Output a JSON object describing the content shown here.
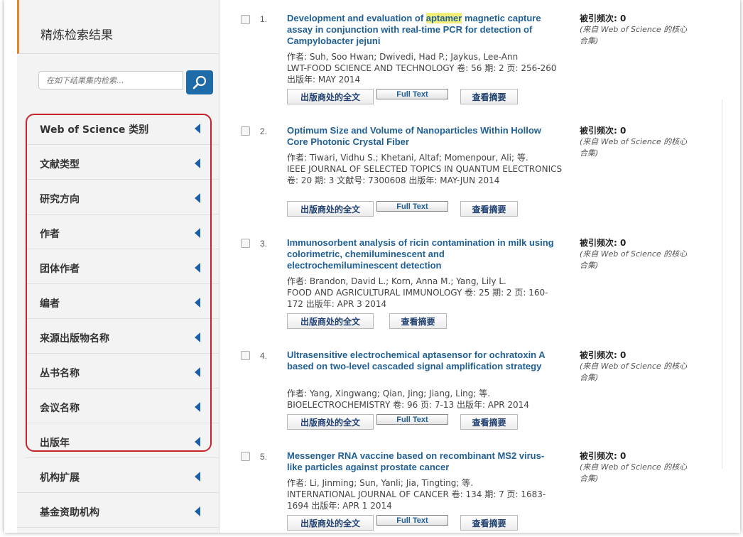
{
  "sidebar": {
    "title": "精炼检索结果",
    "search_placeholder": "在如下结果集内检索...",
    "facets": [
      "Web of Science 类别",
      "文献类型",
      "研究方向",
      "作者",
      "团体作者",
      "编者",
      "来源出版物名称",
      "丛书名称",
      "会议名称",
      "出版年",
      "机构扩展",
      "基金资助机构"
    ]
  },
  "buttons": {
    "publisher_fulltext": "出版商处的全文",
    "full_text": "Full Text",
    "view_abstract": "查看摘要"
  },
  "cited_label": "被引频次: 0",
  "cited_source": "(来自 Web of Science 的核心合集)",
  "results": [
    {
      "num": "1.",
      "title_pre": "Development and evaluation of ",
      "title_hl": "aptamer",
      "title_post": " magnetic capture assay in conjunction with real-time PCR for detection of Campylobacter jejuni",
      "authors": "作者: Suh, Soo Hwan; Dwivedi, Had P.; Jaykus, Lee-Ann",
      "source": "LWT-FOOD SCIENCE AND TECHNOLOGY  卷: 56   期: 2   页: 256-260   出版年: MAY 2014"
    },
    {
      "num": "2.",
      "title": "Optimum Size and Volume of Nanoparticles Within Hollow Core Photonic Crystal Fiber",
      "authors": "作者: Tiwari, Vidhu S.; Khetani, Altaf; Momenpour, Ali; 等.",
      "source": "IEEE JOURNAL OF SELECTED TOPICS IN QUANTUM ELECTRONICS  卷: 20   期: 3    文献号: 7300608   出版年: MAY-JUN 2014"
    },
    {
      "num": "3.",
      "title": "Immunosorbent analysis of ricin contamination in milk using colorimetric, chemiluminescent and electrochemiluminescent detection",
      "authors": "作者: Brandon, David L.; Korn, Anna M.; Yang, Lily L.",
      "source": "FOOD AND AGRICULTURAL IMMUNOLOGY  卷: 25   期: 2   页: 160-172   出版年: APR 3 2014"
    },
    {
      "num": "4.",
      "title": "Ultrasensitive electrochemical aptasensor for ochratoxin A based on two-level cascaded signal amplification strategy",
      "authors": "作者: Yang, Xingwang; Qian, Jing; Jiang, Ling; 等.",
      "source": "BIOELECTROCHEMISTRY  卷: 96   页: 7-13   出版年: APR 2014"
    },
    {
      "num": "5.",
      "title": "Messenger RNA vaccine based on recombinant MS2 virus-like particles against prostate cancer",
      "authors": "作者: Li, Jinming; Sun, Yanli; Jia, Tingting; 等.",
      "source": "INTERNATIONAL JOURNAL OF CANCER  卷: 134   期: 7   页: 1683-1694   出版年: APR 1 2014"
    }
  ],
  "colors": {
    "accent": "#e8862a",
    "link": "#1f5f95",
    "arrow": "#1a5fa8",
    "highlight_box": "#c8232b"
  }
}
